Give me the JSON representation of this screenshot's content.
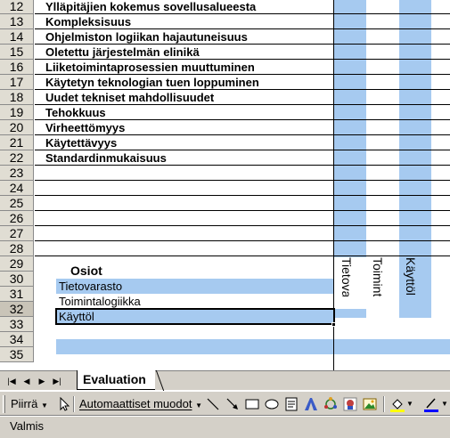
{
  "sheet": {
    "rows": [
      {
        "num": "12",
        "label": "Ylläpitäjien kokemus sovellusalueesta"
      },
      {
        "num": "13",
        "label": "Kompleksisuus"
      },
      {
        "num": "14",
        "label": "Ohjelmiston logiikan hajautuneisuus"
      },
      {
        "num": "15",
        "label": "Oletettu järjestelmän elinikä"
      },
      {
        "num": "16",
        "label": "Liiketoimintaprosessien muuttuminen"
      },
      {
        "num": "17",
        "label": "Käytetyn teknologian tuen loppuminen"
      },
      {
        "num": "18",
        "label": "Uudet tekniset mahdollisuudet"
      },
      {
        "num": "19",
        "label": "Tehokkuus"
      },
      {
        "num": "20",
        "label": "Virheettömyys"
      },
      {
        "num": "21",
        "label": "Käytettävyys"
      },
      {
        "num": "22",
        "label": "Standardinmukaisuus"
      },
      {
        "num": "23",
        "label": ""
      },
      {
        "num": "24",
        "label": ""
      },
      {
        "num": "25",
        "label": ""
      },
      {
        "num": "26",
        "label": ""
      },
      {
        "num": "27",
        "label": ""
      },
      {
        "num": "28",
        "label": ""
      },
      {
        "num": "29",
        "label": ""
      },
      {
        "num": "30",
        "label": ""
      },
      {
        "num": "31",
        "label": ""
      },
      {
        "num": "32",
        "label": ""
      },
      {
        "num": "33",
        "label": ""
      },
      {
        "num": "34",
        "label": ""
      },
      {
        "num": "35",
        "label": ""
      }
    ],
    "active_row": "32",
    "column_headers": [
      "Tietova",
      "Toiminta",
      "Käyttöl"
    ],
    "legend_title": "Osiot",
    "legend_items": [
      "Tietovarasto",
      "Toimintalogiikka",
      "Käyttöl"
    ],
    "highlight_color": "#a6caf0"
  },
  "tabs": {
    "nav": [
      "first-sheet",
      "prev-sheet",
      "next-sheet",
      "last-sheet"
    ],
    "sheet_name": "Evaluation"
  },
  "drawing_toolbar": {
    "draw_label": "Piirrä",
    "autoshapes_label": "Automaattiset muodot",
    "icons": [
      "select-arrow-icon",
      "line-icon",
      "arrow-icon",
      "rectangle-icon",
      "oval-icon",
      "textbox-icon",
      "wordart-icon",
      "diagram-icon",
      "clipart-icon",
      "picture-icon",
      "fill-color-icon",
      "line-color-icon"
    ]
  },
  "status": {
    "text": "Valmis"
  }
}
